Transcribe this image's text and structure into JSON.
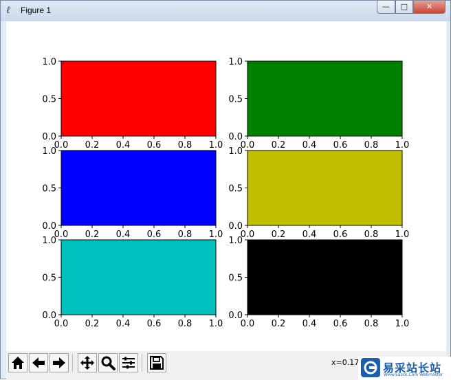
{
  "window": {
    "title": "Figure 1",
    "minimize_glyph": "—",
    "maximize_glyph": "□",
    "close_glyph": "✕"
  },
  "chart_data": [
    {
      "type": "area",
      "fill_color": "#ff0000",
      "xlim": [
        0,
        1
      ],
      "ylim": [
        0,
        1
      ],
      "xticks": [
        "0.0",
        "0.2",
        "0.4",
        "0.6",
        "0.8",
        "1.0"
      ],
      "yticks": [
        "0.0",
        "0.5",
        "1.0"
      ],
      "grid": false
    },
    {
      "type": "area",
      "fill_color": "#008000",
      "xlim": [
        0,
        1
      ],
      "ylim": [
        0,
        1
      ],
      "xticks": [
        "0.0",
        "0.2",
        "0.4",
        "0.6",
        "0.8",
        "1.0"
      ],
      "yticks": [
        "0.0",
        "0.5",
        "1.0"
      ],
      "grid": false
    },
    {
      "type": "area",
      "fill_color": "#0000ff",
      "xlim": [
        0,
        1
      ],
      "ylim": [
        0,
        1
      ],
      "xticks": [
        "0.0",
        "0.2",
        "0.4",
        "0.6",
        "0.8",
        "1.0"
      ],
      "yticks": [
        "0.0",
        "0.5",
        "1.0"
      ],
      "grid": false
    },
    {
      "type": "area",
      "fill_color": "#bfbf00",
      "xlim": [
        0,
        1
      ],
      "ylim": [
        0,
        1
      ],
      "xticks": [
        "0.0",
        "0.2",
        "0.4",
        "0.6",
        "0.8",
        "1.0"
      ],
      "yticks": [
        "0.0",
        "0.5",
        "1.0"
      ],
      "grid": false
    },
    {
      "type": "area",
      "fill_color": "#00bfbf",
      "xlim": [
        0,
        1
      ],
      "ylim": [
        0,
        1
      ],
      "xticks": [
        "0.0",
        "0.2",
        "0.4",
        "0.6",
        "0.8",
        "1.0"
      ],
      "yticks": [
        "0.0",
        "0.5",
        "1.0"
      ],
      "grid": false
    },
    {
      "type": "area",
      "fill_color": "#000000",
      "xlim": [
        0,
        1
      ],
      "ylim": [
        0,
        1
      ],
      "xticks": [
        "0.0",
        "0.2",
        "0.4",
        "0.6",
        "0.8",
        "1.0"
      ],
      "yticks": [
        "0.0",
        "0.5",
        "1.0"
      ],
      "grid": false
    }
  ],
  "toolbar": {
    "buttons": [
      {
        "name": "home-button",
        "icon": "home-icon"
      },
      {
        "name": "back-button",
        "icon": "arrow-left-icon"
      },
      {
        "name": "forward-button",
        "icon": "arrow-right-icon"
      },
      {
        "name": "pan-button",
        "icon": "move-icon"
      },
      {
        "name": "zoom-button",
        "icon": "magnifier-icon"
      },
      {
        "name": "configure-subplots-button",
        "icon": "sliders-icon"
      },
      {
        "name": "save-button",
        "icon": "floppy-disk-icon"
      }
    ],
    "coords_text": "x=0.17"
  },
  "watermark": {
    "text": "易采站长站",
    "subtext": "Www.Easck.Com  Webmaster"
  }
}
